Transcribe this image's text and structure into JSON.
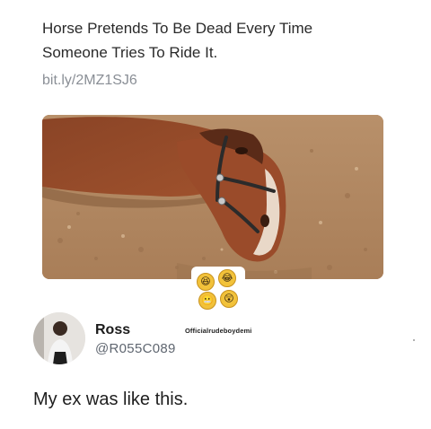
{
  "headline": {
    "line1": "Horse Pretends To Be Dead Every Time",
    "line2": "Someone Tries To Ride It."
  },
  "link": "bit.ly/2MZ1SJ6",
  "image": {
    "subject": "horse-lying-on-dirt"
  },
  "reactions": {
    "watermark": "Officialrudeboydemi",
    "emoji_icons": [
      "laughing-face-icon",
      "crying-laughing-face-icon",
      "grimacing-face-icon",
      "shocked-face-icon"
    ]
  },
  "user": {
    "name": "Ross",
    "handle": "@R055C089"
  },
  "post": {
    "text": "My ex was like this."
  },
  "colors": {
    "headline": "#2a2a2a",
    "link": "#8a8f96",
    "handle": "#5f6670",
    "emoji": "#f2c23a"
  }
}
